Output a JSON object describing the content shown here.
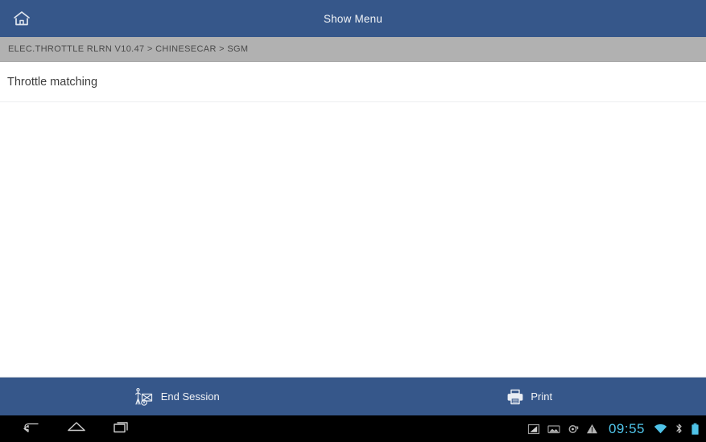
{
  "titlebar": {
    "home_icon": "home-icon",
    "title": "Show Menu"
  },
  "breadcrumb": {
    "text": "ELEC.THROTTLE RLRN V10.47 > CHINESECAR > SGM"
  },
  "main": {
    "menu_items": [
      {
        "label": "Throttle matching"
      }
    ]
  },
  "toolbar": {
    "buttons": [
      {
        "label": "End Session",
        "icon": "end-session-icon"
      },
      {
        "label": "Print",
        "icon": "printer-icon"
      }
    ]
  },
  "system_bar": {
    "nav": [
      {
        "name": "back-icon"
      },
      {
        "name": "home-icon"
      },
      {
        "name": "recents-icon"
      }
    ],
    "status_icons": [
      {
        "name": "screenshot-icon"
      },
      {
        "name": "picture-icon"
      },
      {
        "name": "sync-icon"
      },
      {
        "name": "warning-icon"
      }
    ],
    "clock": "09:55",
    "right_icons": [
      {
        "name": "wifi-icon"
      },
      {
        "name": "bluetooth-icon"
      },
      {
        "name": "battery-icon"
      }
    ]
  },
  "colors": {
    "header_blue": "#36578a",
    "breadcrumb_gray": "#b1b1b1",
    "content_white": "#ffffff",
    "sysbar_black": "#000000",
    "accent_cyan": "#4fc3e8"
  }
}
